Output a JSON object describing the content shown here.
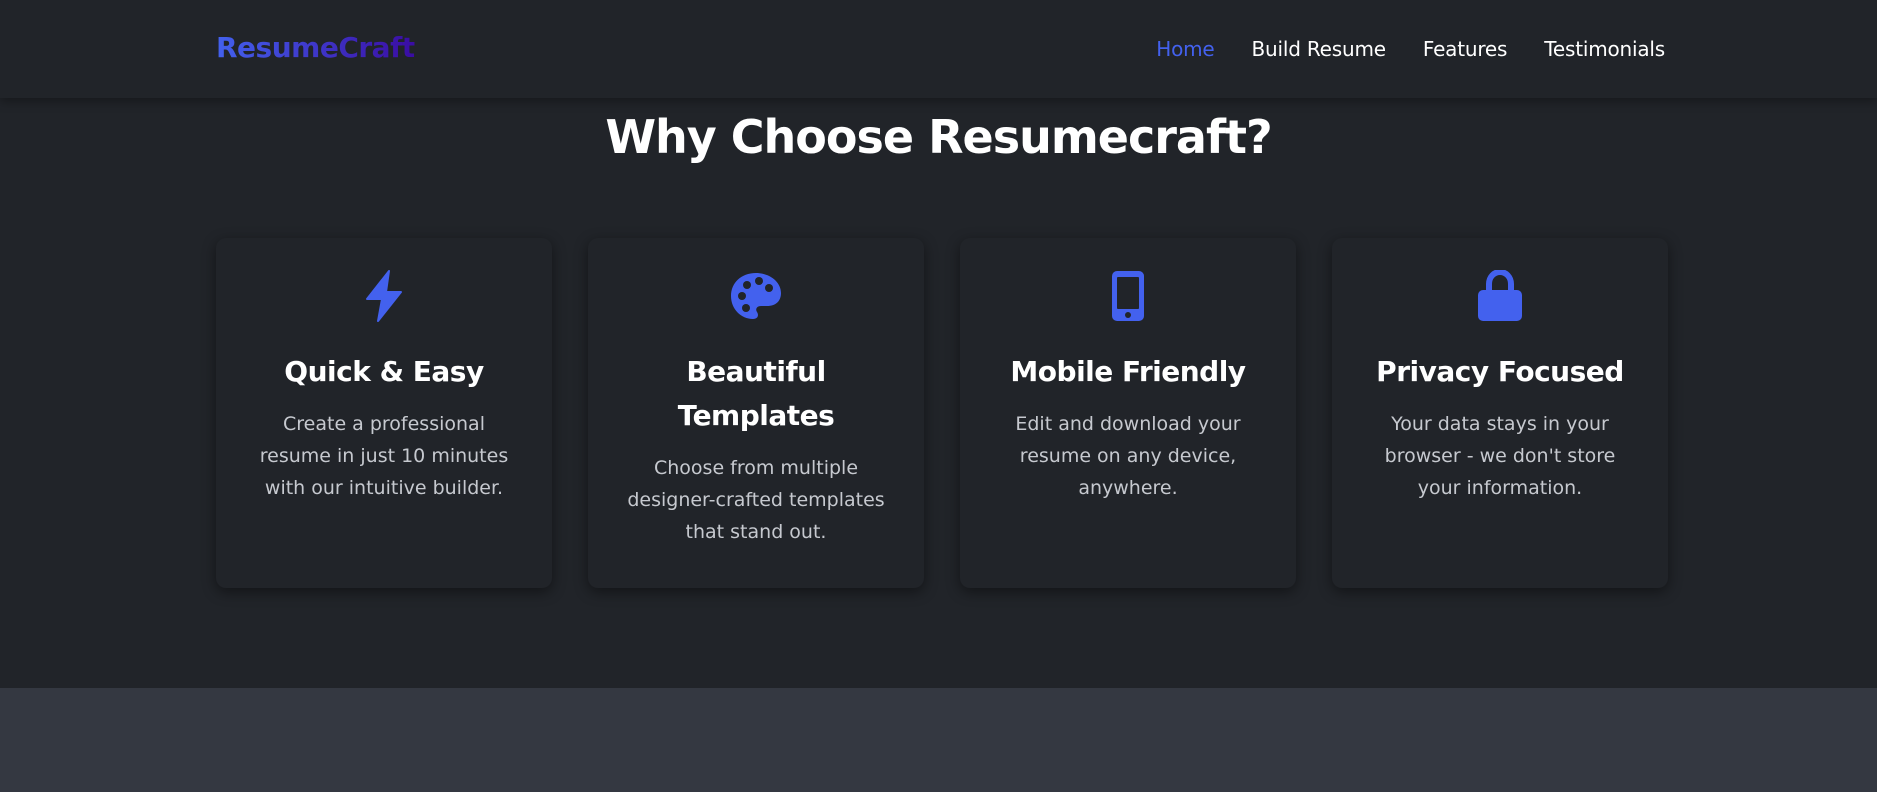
{
  "brand": {
    "name": "ResumeCraft"
  },
  "nav": {
    "links": [
      {
        "label": "Home",
        "active": true
      },
      {
        "label": "Build Resume",
        "active": false
      },
      {
        "label": "Features",
        "active": false
      },
      {
        "label": "Testimonials",
        "active": false
      }
    ]
  },
  "features": {
    "title": "Why Choose Resumecraft?",
    "cards": [
      {
        "icon": "bolt-icon",
        "title": "Quick & Easy",
        "text": "Create a professional resume in just 10 minutes with our intuitive builder."
      },
      {
        "icon": "palette-icon",
        "title": "Beautiful Templates",
        "text": "Choose from multiple designer-crafted templates that stand out."
      },
      {
        "icon": "mobile-icon",
        "title": "Mobile Friendly",
        "text": "Edit and download your resume on any device, anywhere."
      },
      {
        "icon": "lock-icon",
        "title": "Privacy Focused",
        "text": "Your data stays in your browser - we don't store your information."
      }
    ]
  },
  "colors": {
    "accent": "#4361ee",
    "brand_gradient_end": "#3a0ca3",
    "background": "#212429",
    "footer_band": "#343841",
    "muted_text": "#c6c9cf"
  }
}
